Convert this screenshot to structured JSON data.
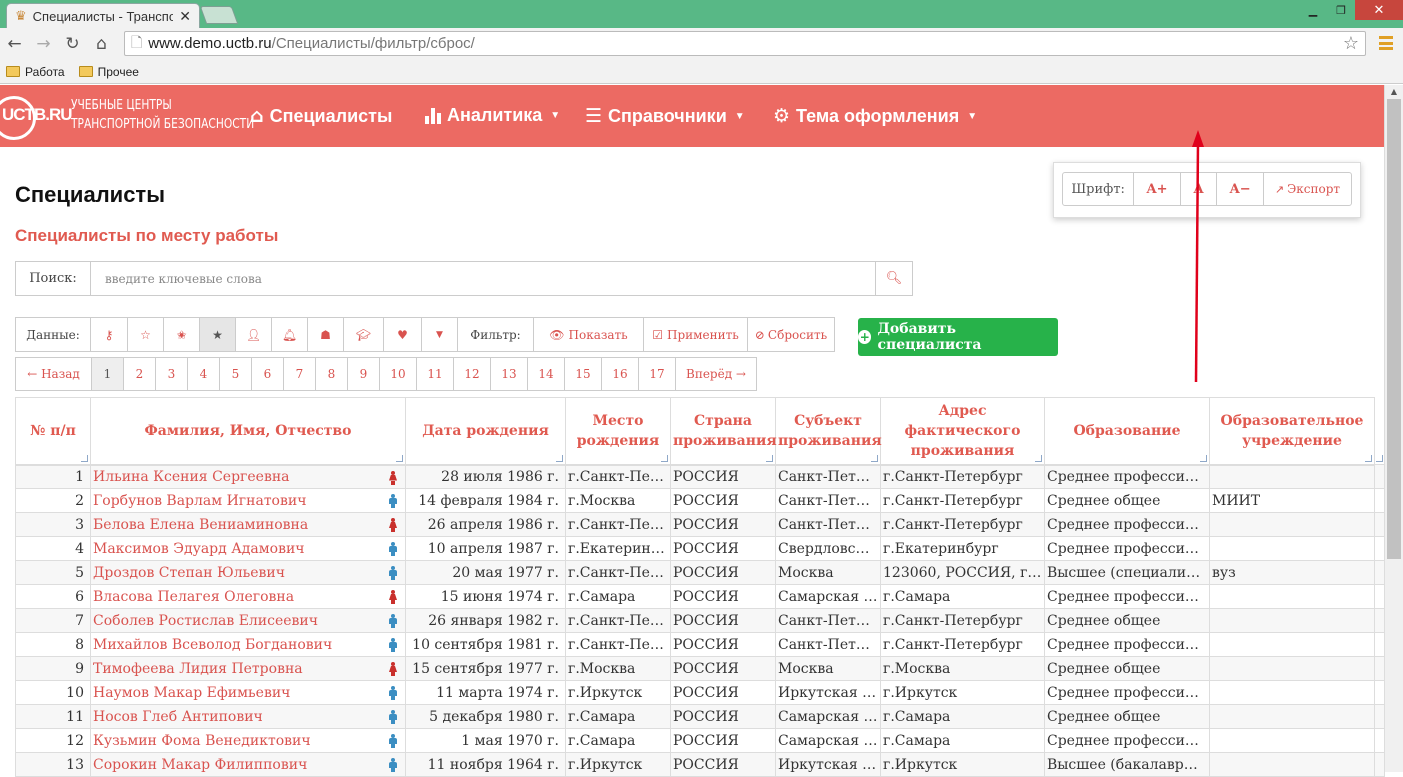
{
  "browser": {
    "tab_title": "Специалисты - Транспор",
    "tab_close": "✕",
    "url_host": "www.demo.uctb.ru",
    "url_path": "/Специалисты/фильтр/сброс/",
    "bookmarks": [
      "Работа",
      "Прочее"
    ]
  },
  "app": {
    "logo": "UCTB.RU",
    "logo_line1": "УЧЕБНЫЕ ЦЕНТРЫ",
    "logo_line2": "ТРАНСПОРТНОЙ БЕЗОПАСНОСТИ",
    "nav": [
      "Специалисты",
      "Аналитика",
      "Справочники",
      "Тема оформления"
    ],
    "accent": "#ec6a63"
  },
  "page": {
    "title": "Специалисты",
    "subtitle": "Специалисты по месту работы"
  },
  "font_panel": {
    "label": "Шрифт:",
    "increase": "A+",
    "reset": "A",
    "decrease": "A−",
    "export": "Экспорт"
  },
  "search": {
    "label": "Поиск:",
    "placeholder": "введите ключевые слова"
  },
  "filterbar": {
    "data_label": "Данные:",
    "filter_label": "Фильтр:",
    "show": "Показать",
    "apply": "Применить",
    "reset": "Сбросить"
  },
  "add_button": "Добавить специалиста",
  "pager": {
    "prev": "← Назад",
    "next": "Вперёд →",
    "pages": [
      "1",
      "2",
      "3",
      "4",
      "5",
      "6",
      "7",
      "8",
      "9",
      "10",
      "11",
      "12",
      "13",
      "14",
      "15",
      "16",
      "17"
    ],
    "current": "1"
  },
  "table": {
    "headers": [
      "№ п/п",
      "Фамилия, Имя, Отчество",
      "Дата рождения",
      "Место рождения",
      "Страна проживания",
      "Субъект проживания",
      "Адрес фактического проживания",
      "Образование",
      "Образовательное учреждение"
    ],
    "rows": [
      {
        "n": "1",
        "name": "Ильина Ксения Сергеевна",
        "sex": "f",
        "date": "28 июля 1986 г.",
        "birth": "г.Санкт-Пет...",
        "country": "РОССИЯ",
        "subject": "Санкт-Петер...",
        "address": "г.Санкт-Петербург",
        "edu": "Среднее профессион...",
        "inst": ""
      },
      {
        "n": "2",
        "name": "Горбунов Варлам Игнатович",
        "sex": "m",
        "date": "14 февраля 1984 г.",
        "birth": "г.Москва",
        "country": "РОССИЯ",
        "subject": "Санкт-Петер...",
        "address": "г.Санкт-Петербург",
        "edu": "Среднее общее",
        "inst": "МИИТ"
      },
      {
        "n": "3",
        "name": "Белова Елена Вениаминовна",
        "sex": "f",
        "date": "26 апреля 1986 г.",
        "birth": "г.Санкт-Пет...",
        "country": "РОССИЯ",
        "subject": "Санкт-Петер...",
        "address": "г.Санкт-Петербург",
        "edu": "Среднее профессион...",
        "inst": ""
      },
      {
        "n": "4",
        "name": "Максимов Эдуард Адамович",
        "sex": "m",
        "date": "10 апреля 1987 г.",
        "birth": "г.Екатеринб...",
        "country": "РОССИЯ",
        "subject": "Свердловска...",
        "address": "г.Екатеринбург",
        "edu": "Среднее профессион...",
        "inst": ""
      },
      {
        "n": "5",
        "name": "Дроздов Степан Юльевич",
        "sex": "m",
        "date": "20 мая 1977 г.",
        "birth": "г.Санкт-Пет...",
        "country": "РОССИЯ",
        "subject": "Москва",
        "address": "123060, РОССИЯ, г. ...",
        "edu": "Высшее (специалитет)",
        "inst": "вуз"
      },
      {
        "n": "6",
        "name": "Власова Пелагея Олеговна",
        "sex": "f",
        "date": "15 июня 1974 г.",
        "birth": "г.Самара",
        "country": "РОССИЯ",
        "subject": "Самарская о...",
        "address": "г.Самара",
        "edu": "Среднее профессион...",
        "inst": ""
      },
      {
        "n": "7",
        "name": "Соболев Ростислав Елисеевич",
        "sex": "m",
        "date": "26 января 1982 г.",
        "birth": "г.Санкт-Пет...",
        "country": "РОССИЯ",
        "subject": "Санкт-Петер...",
        "address": "г.Санкт-Петербург",
        "edu": "Среднее общее",
        "inst": ""
      },
      {
        "n": "8",
        "name": "Михайлов Всеволод Богданович",
        "sex": "m",
        "date": "10 сентября 1981 г.",
        "birth": "г.Санкт-Пет...",
        "country": "РОССИЯ",
        "subject": "Санкт-Петер...",
        "address": "г.Санкт-Петербург",
        "edu": "Среднее профессион...",
        "inst": ""
      },
      {
        "n": "9",
        "name": "Тимофеева Лидия Петровна",
        "sex": "f",
        "date": "15 сентября 1977 г.",
        "birth": "г.Москва",
        "country": "РОССИЯ",
        "subject": "Москва",
        "address": "г.Москва",
        "edu": "Среднее общее",
        "inst": ""
      },
      {
        "n": "10",
        "name": "Наумов Макар Ефимьевич",
        "sex": "m",
        "date": "11 марта 1974 г.",
        "birth": "г.Иркутск",
        "country": "РОССИЯ",
        "subject": "Иркутская о...",
        "address": "г.Иркутск",
        "edu": "Среднее профессион...",
        "inst": ""
      },
      {
        "n": "11",
        "name": "Носов Глеб Антипович",
        "sex": "m",
        "date": "5 декабря 1980 г.",
        "birth": "г.Самара",
        "country": "РОССИЯ",
        "subject": "Самарская о...",
        "address": "г.Самара",
        "edu": "Среднее общее",
        "inst": ""
      },
      {
        "n": "12",
        "name": "Кузьмин Фома Венедиктович",
        "sex": "m",
        "date": "1 мая 1970 г.",
        "birth": "г.Самара",
        "country": "РОССИЯ",
        "subject": "Самарская о...",
        "address": "г.Самара",
        "edu": "Среднее профессион...",
        "inst": ""
      },
      {
        "n": "13",
        "name": "Сорокин Макар Филиппович",
        "sex": "m",
        "date": "11 ноября 1964 г.",
        "birth": "г.Иркутск",
        "country": "РОССИЯ",
        "subject": "Иркутская о...",
        "address": "г.Иркутск",
        "edu": "Высшее (бакалавриат)",
        "inst": ""
      }
    ]
  },
  "colors": {
    "female_icon": "#c9302c",
    "male_icon": "#3b8ec2",
    "annotation_arrow": "#e0001b"
  }
}
